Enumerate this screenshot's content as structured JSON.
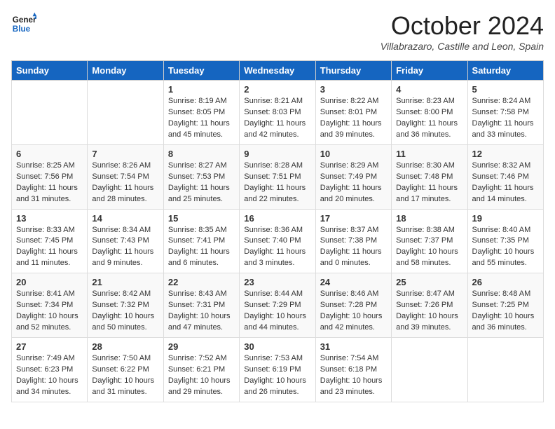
{
  "header": {
    "logo_line1": "General",
    "logo_line2": "Blue",
    "month_title": "October 2024",
    "location": "Villabrazaro, Castille and Leon, Spain"
  },
  "days_of_week": [
    "Sunday",
    "Monday",
    "Tuesday",
    "Wednesday",
    "Thursday",
    "Friday",
    "Saturday"
  ],
  "weeks": [
    [
      {
        "day": "",
        "content": ""
      },
      {
        "day": "",
        "content": ""
      },
      {
        "day": "1",
        "content": "Sunrise: 8:19 AM\nSunset: 8:05 PM\nDaylight: 11 hours and 45 minutes."
      },
      {
        "day": "2",
        "content": "Sunrise: 8:21 AM\nSunset: 8:03 PM\nDaylight: 11 hours and 42 minutes."
      },
      {
        "day": "3",
        "content": "Sunrise: 8:22 AM\nSunset: 8:01 PM\nDaylight: 11 hours and 39 minutes."
      },
      {
        "day": "4",
        "content": "Sunrise: 8:23 AM\nSunset: 8:00 PM\nDaylight: 11 hours and 36 minutes."
      },
      {
        "day": "5",
        "content": "Sunrise: 8:24 AM\nSunset: 7:58 PM\nDaylight: 11 hours and 33 minutes."
      }
    ],
    [
      {
        "day": "6",
        "content": "Sunrise: 8:25 AM\nSunset: 7:56 PM\nDaylight: 11 hours and 31 minutes."
      },
      {
        "day": "7",
        "content": "Sunrise: 8:26 AM\nSunset: 7:54 PM\nDaylight: 11 hours and 28 minutes."
      },
      {
        "day": "8",
        "content": "Sunrise: 8:27 AM\nSunset: 7:53 PM\nDaylight: 11 hours and 25 minutes."
      },
      {
        "day": "9",
        "content": "Sunrise: 8:28 AM\nSunset: 7:51 PM\nDaylight: 11 hours and 22 minutes."
      },
      {
        "day": "10",
        "content": "Sunrise: 8:29 AM\nSunset: 7:49 PM\nDaylight: 11 hours and 20 minutes."
      },
      {
        "day": "11",
        "content": "Sunrise: 8:30 AM\nSunset: 7:48 PM\nDaylight: 11 hours and 17 minutes."
      },
      {
        "day": "12",
        "content": "Sunrise: 8:32 AM\nSunset: 7:46 PM\nDaylight: 11 hours and 14 minutes."
      }
    ],
    [
      {
        "day": "13",
        "content": "Sunrise: 8:33 AM\nSunset: 7:45 PM\nDaylight: 11 hours and 11 minutes."
      },
      {
        "day": "14",
        "content": "Sunrise: 8:34 AM\nSunset: 7:43 PM\nDaylight: 11 hours and 9 minutes."
      },
      {
        "day": "15",
        "content": "Sunrise: 8:35 AM\nSunset: 7:41 PM\nDaylight: 11 hours and 6 minutes."
      },
      {
        "day": "16",
        "content": "Sunrise: 8:36 AM\nSunset: 7:40 PM\nDaylight: 11 hours and 3 minutes."
      },
      {
        "day": "17",
        "content": "Sunrise: 8:37 AM\nSunset: 7:38 PM\nDaylight: 11 hours and 0 minutes."
      },
      {
        "day": "18",
        "content": "Sunrise: 8:38 AM\nSunset: 7:37 PM\nDaylight: 10 hours and 58 minutes."
      },
      {
        "day": "19",
        "content": "Sunrise: 8:40 AM\nSunset: 7:35 PM\nDaylight: 10 hours and 55 minutes."
      }
    ],
    [
      {
        "day": "20",
        "content": "Sunrise: 8:41 AM\nSunset: 7:34 PM\nDaylight: 10 hours and 52 minutes."
      },
      {
        "day": "21",
        "content": "Sunrise: 8:42 AM\nSunset: 7:32 PM\nDaylight: 10 hours and 50 minutes."
      },
      {
        "day": "22",
        "content": "Sunrise: 8:43 AM\nSunset: 7:31 PM\nDaylight: 10 hours and 47 minutes."
      },
      {
        "day": "23",
        "content": "Sunrise: 8:44 AM\nSunset: 7:29 PM\nDaylight: 10 hours and 44 minutes."
      },
      {
        "day": "24",
        "content": "Sunrise: 8:46 AM\nSunset: 7:28 PM\nDaylight: 10 hours and 42 minutes."
      },
      {
        "day": "25",
        "content": "Sunrise: 8:47 AM\nSunset: 7:26 PM\nDaylight: 10 hours and 39 minutes."
      },
      {
        "day": "26",
        "content": "Sunrise: 8:48 AM\nSunset: 7:25 PM\nDaylight: 10 hours and 36 minutes."
      }
    ],
    [
      {
        "day": "27",
        "content": "Sunrise: 7:49 AM\nSunset: 6:23 PM\nDaylight: 10 hours and 34 minutes."
      },
      {
        "day": "28",
        "content": "Sunrise: 7:50 AM\nSunset: 6:22 PM\nDaylight: 10 hours and 31 minutes."
      },
      {
        "day": "29",
        "content": "Sunrise: 7:52 AM\nSunset: 6:21 PM\nDaylight: 10 hours and 29 minutes."
      },
      {
        "day": "30",
        "content": "Sunrise: 7:53 AM\nSunset: 6:19 PM\nDaylight: 10 hours and 26 minutes."
      },
      {
        "day": "31",
        "content": "Sunrise: 7:54 AM\nSunset: 6:18 PM\nDaylight: 10 hours and 23 minutes."
      },
      {
        "day": "",
        "content": ""
      },
      {
        "day": "",
        "content": ""
      }
    ]
  ]
}
